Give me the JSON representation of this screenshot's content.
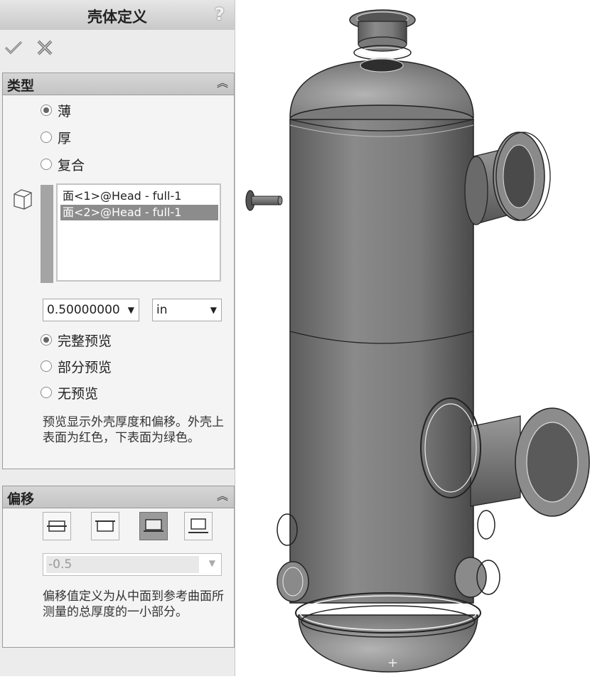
{
  "panel": {
    "title": "壳体定义",
    "help_label": "?",
    "ok_icon": "checkmark-icon",
    "cancel_icon": "cross-icon"
  },
  "type_section": {
    "title": "类型",
    "options": [
      {
        "label": "薄",
        "selected": true
      },
      {
        "label": "厚",
        "selected": false
      },
      {
        "label": "复合",
        "selected": false
      }
    ],
    "faces": [
      "面<1>@Head - full-1",
      "面<2>@Head - full-1"
    ],
    "selected_face": 1,
    "thickness": "0.50000000",
    "unit": "in",
    "preview_options": [
      {
        "label": "完整预览",
        "selected": true
      },
      {
        "label": "部分预览",
        "selected": false
      },
      {
        "label": "无预览",
        "selected": false
      }
    ],
    "note": "预览显示外壳厚度和偏移。外壳上表面为红色，下表面为绿色。"
  },
  "offset_section": {
    "title": "偏移",
    "selected_button": 2,
    "value": "-0.5",
    "note": "偏移值定义为从中面到参考曲面所测量的总厚度的一小部分。"
  },
  "viewport": {
    "description_icon": "pressure-vessel-model"
  }
}
